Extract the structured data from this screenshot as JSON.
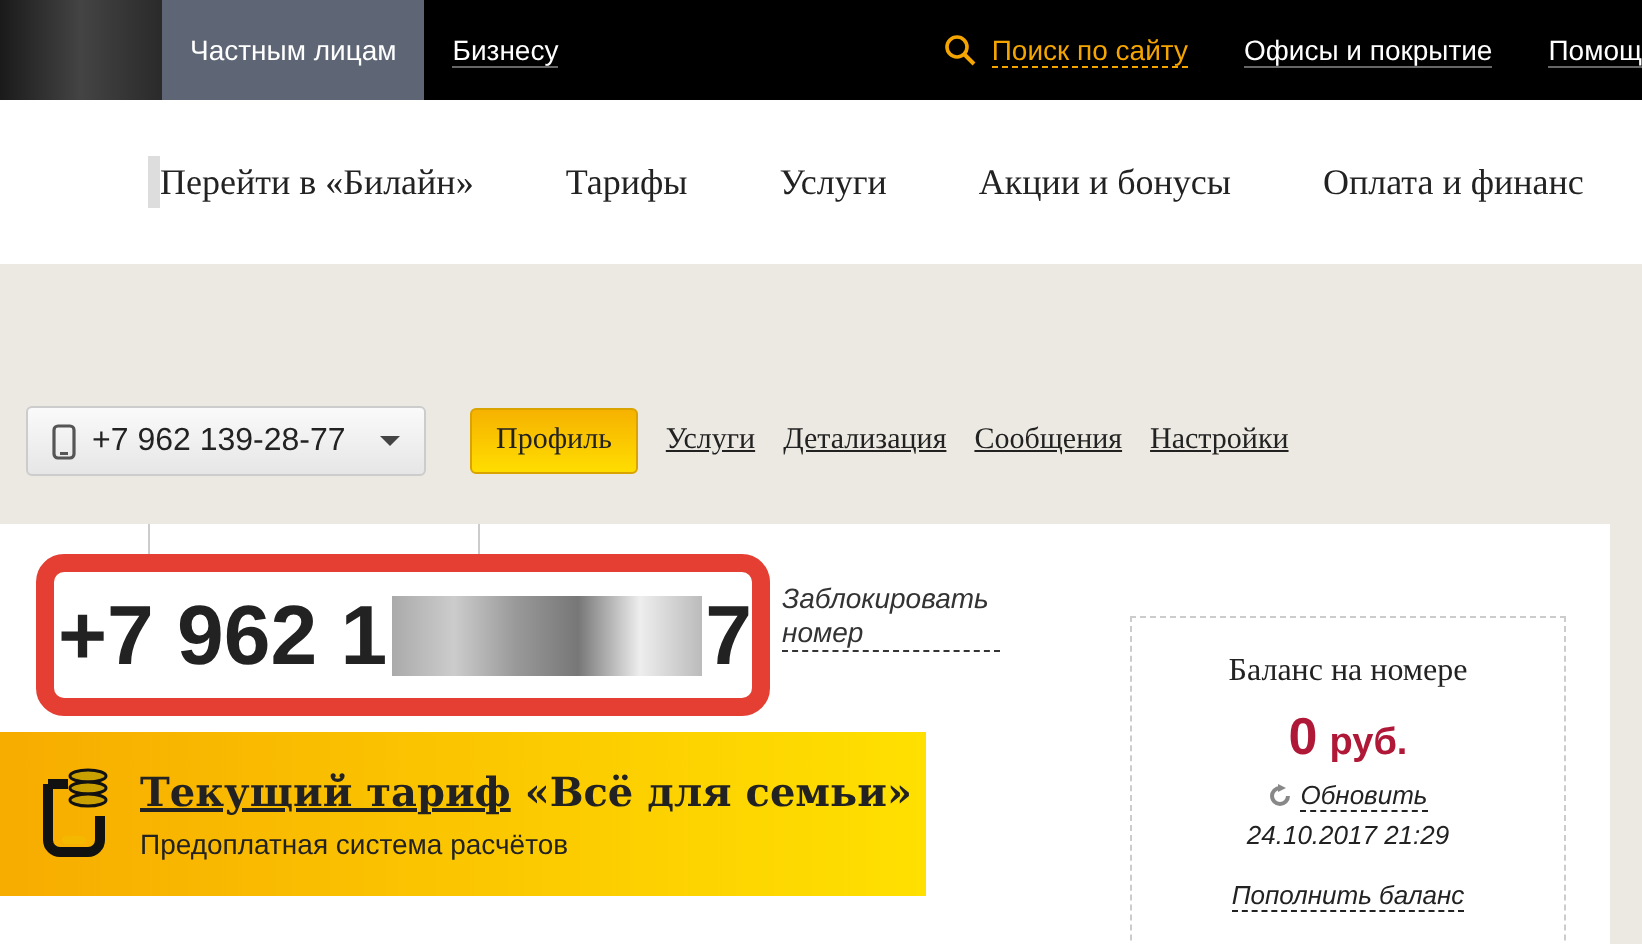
{
  "top_bar": {
    "segments": [
      {
        "label": "Частным лицам",
        "selected": true
      },
      {
        "label": "Бизнесу",
        "selected": false
      }
    ],
    "search_link": "Поиск по сайту",
    "links": [
      "Офисы и покрытие",
      "Помощ"
    ]
  },
  "main_nav": [
    "Перейти в «Билайн»",
    "Тарифы",
    "Услуги",
    "Акции и бонусы",
    "Оплата и финанс"
  ],
  "number_select": {
    "value": "+7 962 139-28-77"
  },
  "tabs": [
    {
      "label": "Профиль",
      "selected": true
    },
    {
      "label": "Услуги",
      "selected": false
    },
    {
      "label": "Детализация",
      "selected": false
    },
    {
      "label": "Сообщения",
      "selected": false
    },
    {
      "label": "Настройки",
      "selected": false
    }
  ],
  "profile": {
    "number_start": "+7 962 1",
    "number_end": "7",
    "block_link": "Заблокировать номер"
  },
  "tariff": {
    "title_link": "Текущий тариф",
    "title_name": "«Всё для семьи»",
    "subtitle": "Предоплатная система расчётов"
  },
  "balance": {
    "title": "Баланс на номере",
    "amount": "0",
    "currency": "руб.",
    "refresh_link": "Обновить",
    "timestamp": "24.10.2017 21:29",
    "top_up_link": "Пополнить баланс"
  }
}
